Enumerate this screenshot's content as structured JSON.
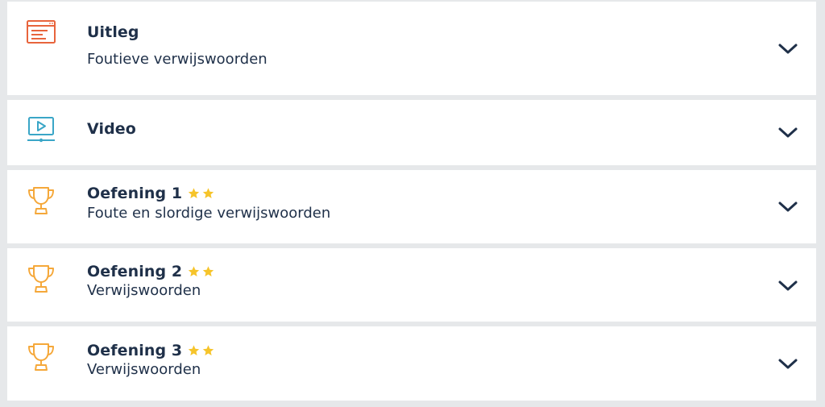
{
  "sections": [
    {
      "icon": "document-icon",
      "icon_color": "#e8643c",
      "title": "Uitleg",
      "stars": 0,
      "subtitle": "Foutieve verwijswoorden"
    },
    {
      "icon": "video-player-icon",
      "icon_color": "#3aa6c7",
      "title": "Video",
      "stars": 0,
      "subtitle": ""
    },
    {
      "icon": "trophy-icon",
      "icon_color": "#f5a83a",
      "title": "Oefening 1",
      "stars": 2,
      "subtitle": "Foute en slordige verwijswoorden"
    },
    {
      "icon": "trophy-icon",
      "icon_color": "#f5a83a",
      "title": "Oefening 2",
      "stars": 2,
      "subtitle": "Verwijswoorden"
    },
    {
      "icon": "trophy-icon",
      "icon_color": "#f5a83a",
      "title": "Oefening 3",
      "stars": 2,
      "subtitle": "Verwijswoorden"
    }
  ],
  "colors": {
    "text": "#1f3049",
    "star": "#f6c42a",
    "chevron": "#1f3049",
    "background": "#e6e8ea"
  }
}
